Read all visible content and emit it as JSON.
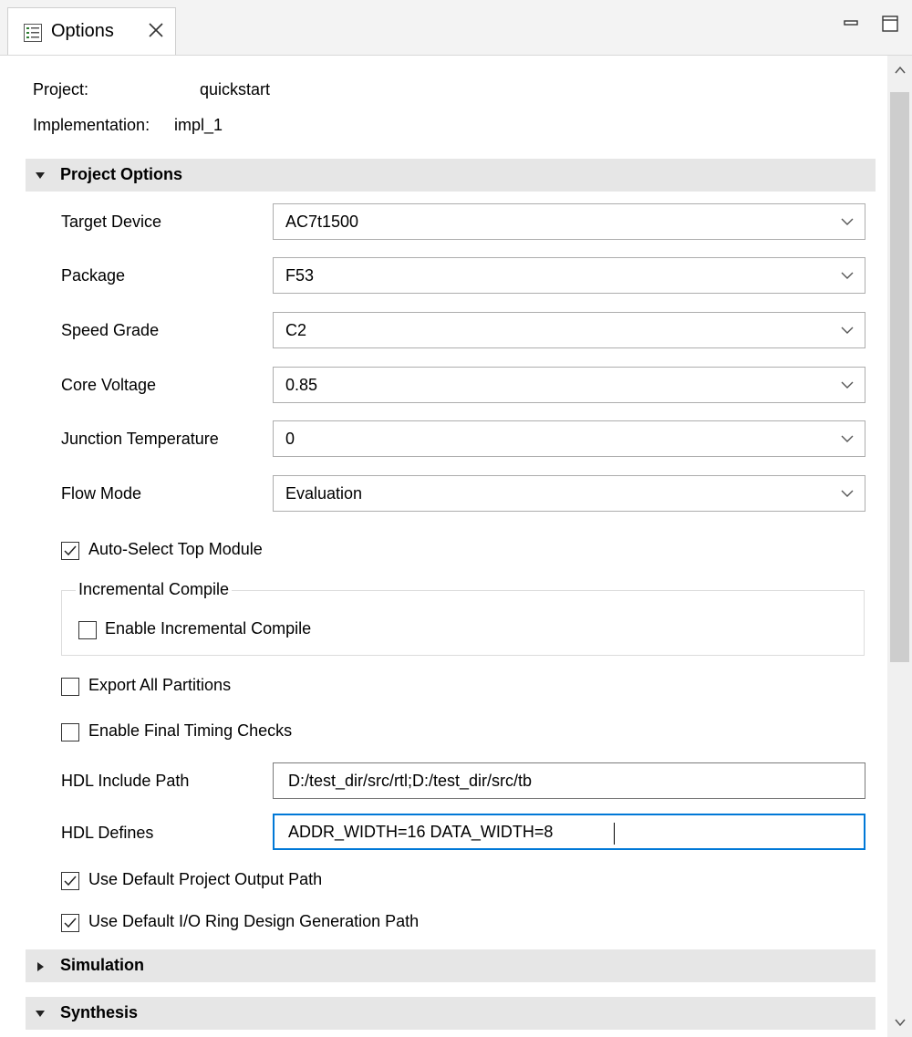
{
  "tab": {
    "title": "Options"
  },
  "info": {
    "project_label": "Project:",
    "project_value": "quickstart",
    "implementation_label": "Implementation:",
    "implementation_value": "impl_1"
  },
  "sections": {
    "project_options": "Project Options",
    "simulation": "Simulation",
    "synthesis": "Synthesis"
  },
  "fields": {
    "target_device": {
      "label": "Target Device",
      "value": "AC7t1500"
    },
    "package": {
      "label": "Package",
      "value": "F53"
    },
    "speed_grade": {
      "label": "Speed Grade",
      "value": "C2"
    },
    "core_voltage": {
      "label": "Core Voltage",
      "value": "0.85"
    },
    "junction_temperature": {
      "label": "Junction Temperature",
      "value": "0"
    },
    "flow_mode": {
      "label": "Flow Mode",
      "value": "Evaluation"
    },
    "hdl_include_path": {
      "label": "HDL Include Path",
      "value": "D:/test_dir/src/rtl;D:/test_dir/src/tb"
    },
    "hdl_defines": {
      "label": "HDL Defines",
      "value": "ADDR_WIDTH=16 DATA_WIDTH=8"
    }
  },
  "checkboxes": {
    "auto_select_top": {
      "label": "Auto-Select Top Module",
      "checked": true
    },
    "incremental_group": "Incremental Compile",
    "enable_incremental": {
      "label": "Enable Incremental Compile",
      "checked": false
    },
    "export_partitions": {
      "label": "Export All Partitions",
      "checked": false
    },
    "final_timing": {
      "label": "Enable Final Timing Checks",
      "checked": false
    },
    "default_output_path": {
      "label": "Use Default Project Output Path",
      "checked": true
    },
    "default_io_ring_path": {
      "label": "Use Default I/O Ring Design Generation Path",
      "checked": true
    }
  },
  "colors": {
    "section_bg": "#e6e6e6",
    "focus_border": "#0078d7",
    "tab_bg": "#f3f3f3"
  }
}
